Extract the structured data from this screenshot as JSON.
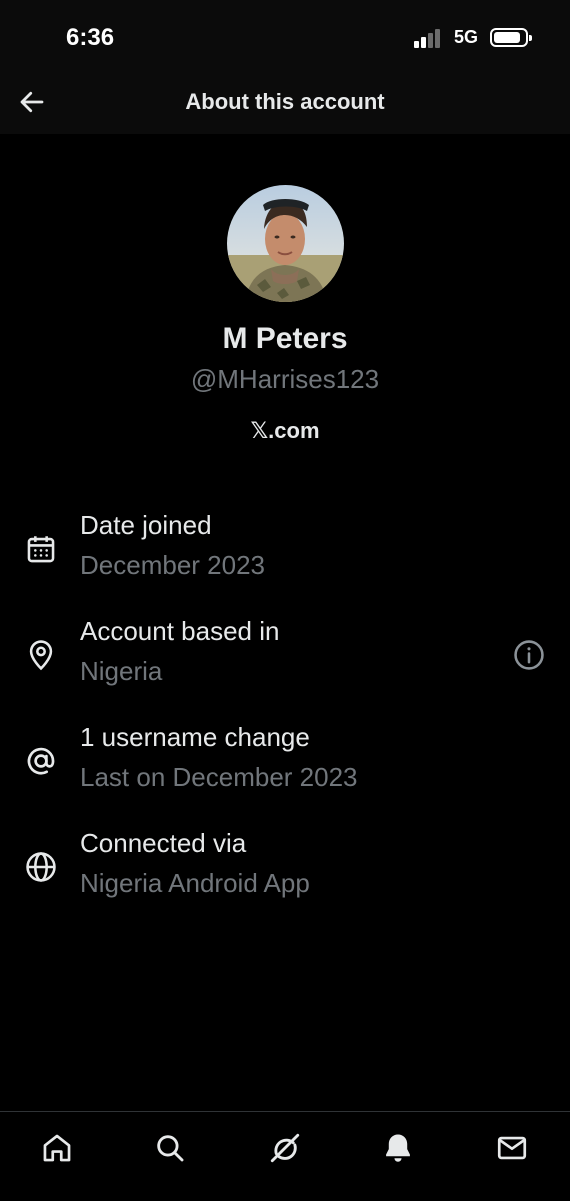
{
  "status_bar": {
    "time": "6:36",
    "network": "5G"
  },
  "header": {
    "title": "About this account",
    "back_icon": "arrow-left-icon"
  },
  "profile": {
    "name": "M Peters",
    "handle": "@MHarrises123",
    "site": "𝕏.com"
  },
  "details": [
    {
      "icon": "calendar-icon",
      "label": "Date joined",
      "value": "December 2023"
    },
    {
      "icon": "location-pin-icon",
      "label": "Account based in",
      "value": "Nigeria",
      "action_icon": "info-icon"
    },
    {
      "icon": "at-sign-icon",
      "label": "1 username change",
      "value": "Last on December 2023"
    },
    {
      "icon": "globe-icon",
      "label": "Connected via",
      "value": "Nigeria Android App"
    }
  ],
  "bottom_nav": [
    {
      "icon": "home-icon"
    },
    {
      "icon": "search-icon"
    },
    {
      "icon": "grok-icon"
    },
    {
      "icon": "bell-icon"
    },
    {
      "icon": "mail-icon"
    }
  ],
  "colors": {
    "background": "#000000",
    "header_background": "#0b0b0b",
    "primary_text": "#e7e9ea",
    "secondary_text": "#71767b",
    "divider": "#2f3336"
  }
}
